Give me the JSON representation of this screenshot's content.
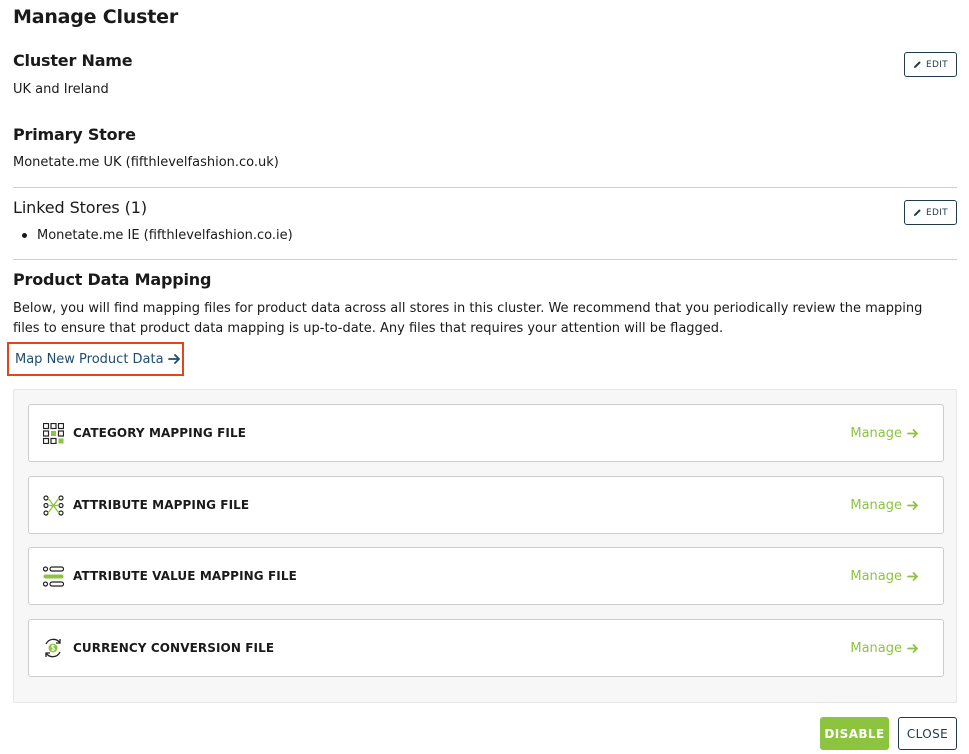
{
  "page": {
    "title": "Manage Cluster"
  },
  "cluster_name": {
    "heading": "Cluster Name",
    "value": "UK and Ireland",
    "edit_label": "EDIT"
  },
  "primary_store": {
    "heading": "Primary Store",
    "value": "Monetate.me UK (fifthlevelfashion.co.uk)"
  },
  "linked_stores": {
    "heading": "Linked Stores (1)",
    "items": [
      "Monetate.me IE (fifthlevelfashion.co.ie)"
    ],
    "edit_label": "EDIT"
  },
  "product_data_mapping": {
    "heading": "Product Data Mapping",
    "description": "Below, you will find mapping files for product data across all stores in this cluster. We recommend that you periodically review the mapping files to ensure that product data mapping is up-to-date. Any files that requires your attention will be flagged.",
    "map_link_label": "Map New Product Data",
    "files": [
      {
        "name": "CATEGORY MAPPING FILE",
        "icon": "category-grid-icon",
        "action": "Manage"
      },
      {
        "name": "ATTRIBUTE MAPPING FILE",
        "icon": "attribute-nodes-icon",
        "action": "Manage"
      },
      {
        "name": "ATTRIBUTE VALUE MAPPING FILE",
        "icon": "value-list-icon",
        "action": "Manage"
      },
      {
        "name": "CURRENCY CONVERSION FILE",
        "icon": "currency-cycle-icon",
        "action": "Manage"
      }
    ]
  },
  "footer": {
    "disable_label": "DISABLE",
    "close_label": "CLOSE"
  },
  "colors": {
    "accent_green": "#8dc43f",
    "navy": "#1f3a4d",
    "link_blue": "#1f4d6e",
    "highlight_red": "#e0461f"
  }
}
